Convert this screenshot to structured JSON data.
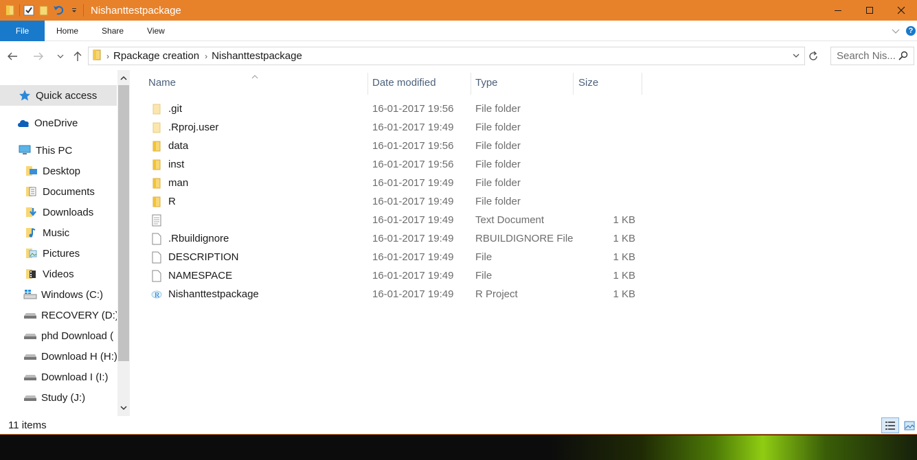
{
  "window": {
    "title": "Nishanttestpackage",
    "accent_color": "#e8822a"
  },
  "ribbon": {
    "tabs": [
      "File",
      "Home",
      "Share",
      "View"
    ],
    "file_tab_color": "#1979ca"
  },
  "address": {
    "breadcrumb": [
      "Rpackage creation",
      "Nishanttestpackage"
    ],
    "search_placeholder": "Search Nis..."
  },
  "nav": {
    "items": [
      {
        "label": "Quick access",
        "icon": "star-icon"
      },
      {
        "label": "OneDrive",
        "icon": "cloud-icon"
      },
      {
        "label": "This PC",
        "icon": "computer-icon"
      },
      {
        "label": "Desktop",
        "icon": "desktop-folder-icon"
      },
      {
        "label": "Documents",
        "icon": "documents-folder-icon"
      },
      {
        "label": "Downloads",
        "icon": "downloads-folder-icon"
      },
      {
        "label": "Music",
        "icon": "music-folder-icon"
      },
      {
        "label": "Pictures",
        "icon": "pictures-folder-icon"
      },
      {
        "label": "Videos",
        "icon": "videos-folder-icon"
      },
      {
        "label": "Windows (C:)",
        "icon": "windows-drive-icon"
      },
      {
        "label": "RECOVERY (D:)",
        "icon": "drive-icon"
      },
      {
        "label": "phd Download (",
        "icon": "drive-icon"
      },
      {
        "label": "Download H (H:)",
        "icon": "drive-icon"
      },
      {
        "label": "Download I (I:)",
        "icon": "drive-icon"
      },
      {
        "label": "Study (J:)",
        "icon": "drive-icon"
      }
    ]
  },
  "files": {
    "columns": [
      "Name",
      "Date modified",
      "Type",
      "Size"
    ],
    "rows": [
      {
        "name": ".git",
        "date": "16-01-2017 19:56",
        "type": "File folder",
        "size": "",
        "icon": "folder-faded-icon"
      },
      {
        "name": ".Rproj.user",
        "date": "16-01-2017 19:49",
        "type": "File folder",
        "size": "",
        "icon": "folder-faded-icon"
      },
      {
        "name": "data",
        "date": "16-01-2017 19:56",
        "type": "File folder",
        "size": "",
        "icon": "folder-icon"
      },
      {
        "name": "inst",
        "date": "16-01-2017 19:56",
        "type": "File folder",
        "size": "",
        "icon": "folder-icon"
      },
      {
        "name": "man",
        "date": "16-01-2017 19:49",
        "type": "File folder",
        "size": "",
        "icon": "folder-icon"
      },
      {
        "name": "R",
        "date": "16-01-2017 19:49",
        "type": "File folder",
        "size": "",
        "icon": "folder-icon"
      },
      {
        "name": "",
        "date": "16-01-2017 19:49",
        "type": "Text Document",
        "size": "1 KB",
        "icon": "text-document-icon"
      },
      {
        "name": ".Rbuildignore",
        "date": "16-01-2017 19:49",
        "type": "RBUILDIGNORE File",
        "size": "1 KB",
        "icon": "file-icon"
      },
      {
        "name": "DESCRIPTION",
        "date": "16-01-2017 19:49",
        "type": "File",
        "size": "1 KB",
        "icon": "file-icon"
      },
      {
        "name": "NAMESPACE",
        "date": "16-01-2017 19:49",
        "type": "File",
        "size": "1 KB",
        "icon": "file-icon"
      },
      {
        "name": "Nishanttestpackage",
        "date": "16-01-2017 19:49",
        "type": "R Project",
        "size": "1 KB",
        "icon": "r-project-icon"
      }
    ]
  },
  "status": {
    "item_count": "11 items"
  }
}
